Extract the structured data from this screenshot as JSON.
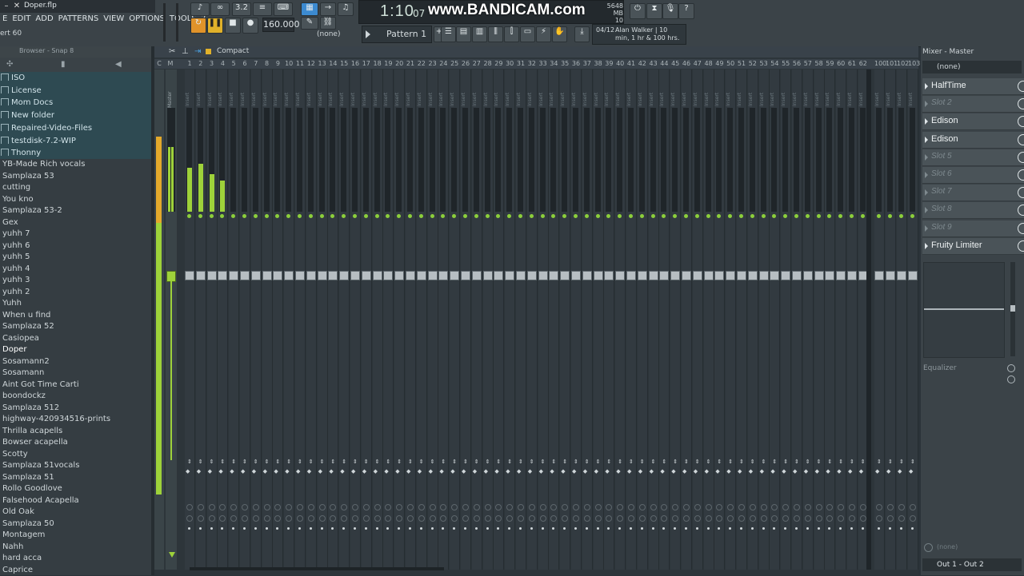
{
  "window": {
    "title": "Doper.flp",
    "hint": "ert 60"
  },
  "menu": [
    "E",
    "EDIT",
    "ADD",
    "PATTERNS",
    "VIEW",
    "OPTIONS",
    "TOOLS",
    "?"
  ],
  "transport": {
    "time": "1:10",
    "time_ms": "07",
    "tempo": "160.000",
    "pattern": "Pattern 1",
    "snap": "(none)",
    "memory": "5648 MB",
    "cpu": "10",
    "watermark": "www.BANDICAM.com"
  },
  "hint_panel": {
    "date": "04/12",
    "message": "Alan Walker | 10 min, 1 hr & 100 hrs."
  },
  "browser": {
    "title": "Browser - Snap 8",
    "folders": [
      "ISO",
      "License",
      "Mom Docs",
      "New folder",
      "Repaired-Video-Files",
      "testdisk-7.2-WIP",
      "Thonny"
    ],
    "files": [
      "YB-Made Rich vocals",
      "Samplaza 53",
      "cutting",
      "You kno",
      "Samplaza 53-2",
      "Gex",
      "yuhh 7",
      "yuhh 6",
      "yuhh 5",
      "yuhh 4",
      "yuhh 3",
      "yuhh 2",
      "Yuhh",
      "When u find",
      "Samplaza 52",
      "Casiopea",
      "Doper",
      "Sosamann2",
      "Sosamann",
      "Aint Got Time Carti",
      "boondockz",
      "Samplaza 512",
      "highway-420934516-prints",
      "Thrilla acapells",
      "Bowser acapella",
      "Scotty",
      "Samplaza 51vocals",
      "Samplaza 51",
      "Rollo Goodlove",
      "Falsehood Acapella",
      "Old Oak",
      "Samplaza 50",
      "Montagem",
      "Nahh",
      "hard acca",
      "Caprice"
    ],
    "active_file": "Doper"
  },
  "mixer": {
    "view_mode": "Compact",
    "track_numbers": [
      "C",
      "M",
      "1",
      "2",
      "3",
      "4",
      "5",
      "6",
      "7",
      "8",
      "9",
      "10",
      "11",
      "12",
      "13",
      "14",
      "15",
      "16",
      "17",
      "18",
      "19",
      "20",
      "21",
      "22",
      "23",
      "24",
      "25",
      "26",
      "27",
      "28",
      "29",
      "30",
      "31",
      "32",
      "33",
      "34",
      "35",
      "36",
      "37",
      "38",
      "39",
      "40",
      "41",
      "42",
      "43",
      "44",
      "45",
      "46",
      "47",
      "48",
      "49",
      "50",
      "51",
      "52",
      "53",
      "54",
      "55",
      "56",
      "57",
      "58",
      "59",
      "60",
      "61",
      "62",
      "100",
      "101",
      "102",
      "103"
    ],
    "master_label": "Master",
    "insert_label": "Insert",
    "active_levels": [
      {
        "track": "1",
        "level": 0.42
      },
      {
        "track": "2",
        "level": 0.46
      },
      {
        "track": "3",
        "level": 0.36
      },
      {
        "track": "4",
        "level": 0.3
      }
    ],
    "master_level": 0.62
  },
  "inspector": {
    "title": "Mixer - Master",
    "input": "(none)",
    "slots": [
      {
        "label": "HalfTime",
        "empty": false
      },
      {
        "label": "Slot 2",
        "empty": true
      },
      {
        "label": "Edison",
        "empty": false
      },
      {
        "label": "Edison",
        "empty": false
      },
      {
        "label": "Slot 5",
        "empty": true
      },
      {
        "label": "Slot 6",
        "empty": true
      },
      {
        "label": "Slot 7",
        "empty": true
      },
      {
        "label": "Slot 8",
        "empty": true
      },
      {
        "label": "Slot 9",
        "empty": true
      },
      {
        "label": "Fruity Limiter",
        "empty": false
      }
    ],
    "eq_label": "Equalizer",
    "out_none": "(none)",
    "output": "Out 1 - Out 2"
  },
  "colors": {
    "accent": "#9ed23a",
    "panel": "#3b4348",
    "folders_bg": "#2e4a52"
  }
}
